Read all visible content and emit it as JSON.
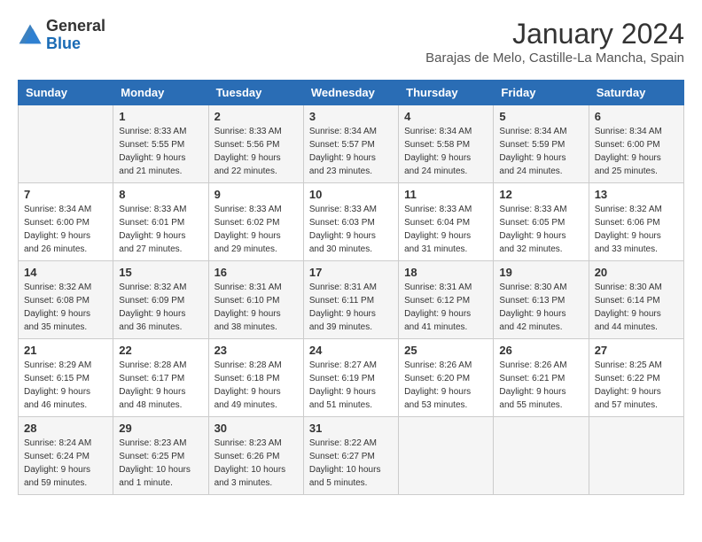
{
  "header": {
    "logo_general": "General",
    "logo_blue": "Blue",
    "month_title": "January 2024",
    "location": "Barajas de Melo, Castille-La Mancha, Spain"
  },
  "days_of_week": [
    "Sunday",
    "Monday",
    "Tuesday",
    "Wednesday",
    "Thursday",
    "Friday",
    "Saturday"
  ],
  "weeks": [
    [
      {
        "day": "",
        "sunrise": "",
        "sunset": "",
        "daylight": ""
      },
      {
        "day": "1",
        "sunrise": "Sunrise: 8:33 AM",
        "sunset": "Sunset: 5:55 PM",
        "daylight": "Daylight: 9 hours and 21 minutes."
      },
      {
        "day": "2",
        "sunrise": "Sunrise: 8:33 AM",
        "sunset": "Sunset: 5:56 PM",
        "daylight": "Daylight: 9 hours and 22 minutes."
      },
      {
        "day": "3",
        "sunrise": "Sunrise: 8:34 AM",
        "sunset": "Sunset: 5:57 PM",
        "daylight": "Daylight: 9 hours and 23 minutes."
      },
      {
        "day": "4",
        "sunrise": "Sunrise: 8:34 AM",
        "sunset": "Sunset: 5:58 PM",
        "daylight": "Daylight: 9 hours and 24 minutes."
      },
      {
        "day": "5",
        "sunrise": "Sunrise: 8:34 AM",
        "sunset": "Sunset: 5:59 PM",
        "daylight": "Daylight: 9 hours and 24 minutes."
      },
      {
        "day": "6",
        "sunrise": "Sunrise: 8:34 AM",
        "sunset": "Sunset: 6:00 PM",
        "daylight": "Daylight: 9 hours and 25 minutes."
      }
    ],
    [
      {
        "day": "7",
        "sunrise": "Sunrise: 8:34 AM",
        "sunset": "Sunset: 6:00 PM",
        "daylight": "Daylight: 9 hours and 26 minutes."
      },
      {
        "day": "8",
        "sunrise": "Sunrise: 8:33 AM",
        "sunset": "Sunset: 6:01 PM",
        "daylight": "Daylight: 9 hours and 27 minutes."
      },
      {
        "day": "9",
        "sunrise": "Sunrise: 8:33 AM",
        "sunset": "Sunset: 6:02 PM",
        "daylight": "Daylight: 9 hours and 29 minutes."
      },
      {
        "day": "10",
        "sunrise": "Sunrise: 8:33 AM",
        "sunset": "Sunset: 6:03 PM",
        "daylight": "Daylight: 9 hours and 30 minutes."
      },
      {
        "day": "11",
        "sunrise": "Sunrise: 8:33 AM",
        "sunset": "Sunset: 6:04 PM",
        "daylight": "Daylight: 9 hours and 31 minutes."
      },
      {
        "day": "12",
        "sunrise": "Sunrise: 8:33 AM",
        "sunset": "Sunset: 6:05 PM",
        "daylight": "Daylight: 9 hours and 32 minutes."
      },
      {
        "day": "13",
        "sunrise": "Sunrise: 8:32 AM",
        "sunset": "Sunset: 6:06 PM",
        "daylight": "Daylight: 9 hours and 33 minutes."
      }
    ],
    [
      {
        "day": "14",
        "sunrise": "Sunrise: 8:32 AM",
        "sunset": "Sunset: 6:08 PM",
        "daylight": "Daylight: 9 hours and 35 minutes."
      },
      {
        "day": "15",
        "sunrise": "Sunrise: 8:32 AM",
        "sunset": "Sunset: 6:09 PM",
        "daylight": "Daylight: 9 hours and 36 minutes."
      },
      {
        "day": "16",
        "sunrise": "Sunrise: 8:31 AM",
        "sunset": "Sunset: 6:10 PM",
        "daylight": "Daylight: 9 hours and 38 minutes."
      },
      {
        "day": "17",
        "sunrise": "Sunrise: 8:31 AM",
        "sunset": "Sunset: 6:11 PM",
        "daylight": "Daylight: 9 hours and 39 minutes."
      },
      {
        "day": "18",
        "sunrise": "Sunrise: 8:31 AM",
        "sunset": "Sunset: 6:12 PM",
        "daylight": "Daylight: 9 hours and 41 minutes."
      },
      {
        "day": "19",
        "sunrise": "Sunrise: 8:30 AM",
        "sunset": "Sunset: 6:13 PM",
        "daylight": "Daylight: 9 hours and 42 minutes."
      },
      {
        "day": "20",
        "sunrise": "Sunrise: 8:30 AM",
        "sunset": "Sunset: 6:14 PM",
        "daylight": "Daylight: 9 hours and 44 minutes."
      }
    ],
    [
      {
        "day": "21",
        "sunrise": "Sunrise: 8:29 AM",
        "sunset": "Sunset: 6:15 PM",
        "daylight": "Daylight: 9 hours and 46 minutes."
      },
      {
        "day": "22",
        "sunrise": "Sunrise: 8:28 AM",
        "sunset": "Sunset: 6:17 PM",
        "daylight": "Daylight: 9 hours and 48 minutes."
      },
      {
        "day": "23",
        "sunrise": "Sunrise: 8:28 AM",
        "sunset": "Sunset: 6:18 PM",
        "daylight": "Daylight: 9 hours and 49 minutes."
      },
      {
        "day": "24",
        "sunrise": "Sunrise: 8:27 AM",
        "sunset": "Sunset: 6:19 PM",
        "daylight": "Daylight: 9 hours and 51 minutes."
      },
      {
        "day": "25",
        "sunrise": "Sunrise: 8:26 AM",
        "sunset": "Sunset: 6:20 PM",
        "daylight": "Daylight: 9 hours and 53 minutes."
      },
      {
        "day": "26",
        "sunrise": "Sunrise: 8:26 AM",
        "sunset": "Sunset: 6:21 PM",
        "daylight": "Daylight: 9 hours and 55 minutes."
      },
      {
        "day": "27",
        "sunrise": "Sunrise: 8:25 AM",
        "sunset": "Sunset: 6:22 PM",
        "daylight": "Daylight: 9 hours and 57 minutes."
      }
    ],
    [
      {
        "day": "28",
        "sunrise": "Sunrise: 8:24 AM",
        "sunset": "Sunset: 6:24 PM",
        "daylight": "Daylight: 9 hours and 59 minutes."
      },
      {
        "day": "29",
        "sunrise": "Sunrise: 8:23 AM",
        "sunset": "Sunset: 6:25 PM",
        "daylight": "Daylight: 10 hours and 1 minute."
      },
      {
        "day": "30",
        "sunrise": "Sunrise: 8:23 AM",
        "sunset": "Sunset: 6:26 PM",
        "daylight": "Daylight: 10 hours and 3 minutes."
      },
      {
        "day": "31",
        "sunrise": "Sunrise: 8:22 AM",
        "sunset": "Sunset: 6:27 PM",
        "daylight": "Daylight: 10 hours and 5 minutes."
      },
      {
        "day": "",
        "sunrise": "",
        "sunset": "",
        "daylight": ""
      },
      {
        "day": "",
        "sunrise": "",
        "sunset": "",
        "daylight": ""
      },
      {
        "day": "",
        "sunrise": "",
        "sunset": "",
        "daylight": ""
      }
    ]
  ]
}
